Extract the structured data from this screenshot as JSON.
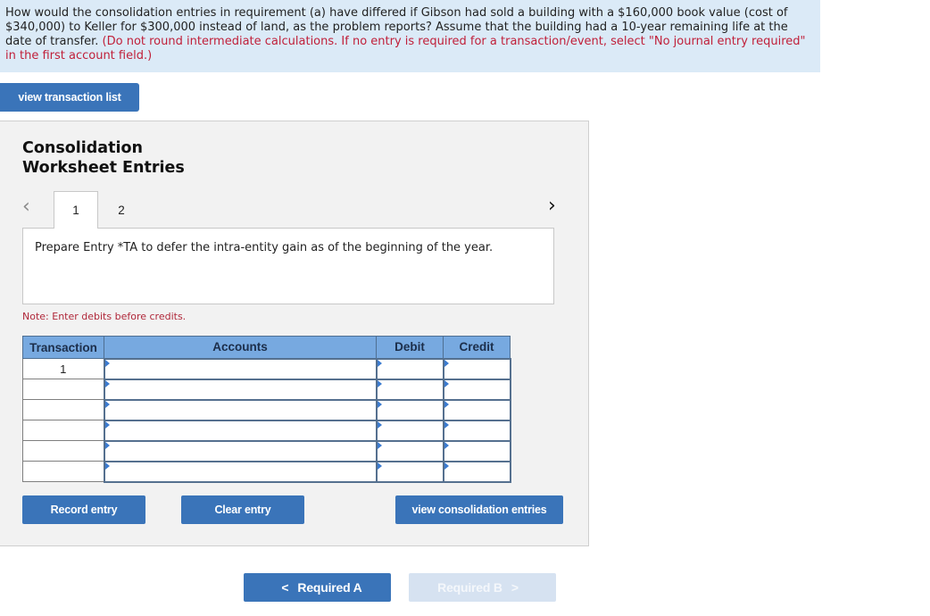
{
  "question": {
    "text": "How would the consolidation entries in requirement (a) have differed if Gibson had sold a building with a $160,000 book value (cost of $340,000) to Keller for $300,000 instead of land, as the problem reports? Assume that the building had a 10-year remaining life at the date of transfer.",
    "hint": "(Do not round intermediate calculations. If no entry is required for a transaction/event, select \"No journal entry required\" in the first account field.)"
  },
  "view_transaction_list_label": "view transaction list",
  "panel": {
    "title_line1": "Consolidation",
    "title_line2": "Worksheet Entries",
    "tabs": [
      {
        "label": "1",
        "active": true
      },
      {
        "label": "2",
        "active": false
      }
    ],
    "prev_icon": "chevron-left-icon",
    "next_icon": "chevron-right-icon",
    "prompt": "Prepare Entry *TA to defer the intra-entity gain as of the beginning of the year.",
    "note": "Note: Enter debits before credits.",
    "table": {
      "headers": [
        "Transaction",
        "Accounts",
        "Debit",
        "Credit"
      ],
      "rows": [
        {
          "transaction": "1",
          "account": "",
          "debit": "",
          "credit": ""
        },
        {
          "transaction": "",
          "account": "",
          "debit": "",
          "credit": ""
        },
        {
          "transaction": "",
          "account": "",
          "debit": "",
          "credit": ""
        },
        {
          "transaction": "",
          "account": "",
          "debit": "",
          "credit": ""
        },
        {
          "transaction": "",
          "account": "",
          "debit": "",
          "credit": ""
        },
        {
          "transaction": "",
          "account": "",
          "debit": "",
          "credit": ""
        }
      ]
    },
    "buttons": {
      "record": "Record entry",
      "clear": "Clear entry",
      "view_consolidation": "view consolidation entries"
    }
  },
  "nav": {
    "prev_label": "Required A",
    "next_label": "Required B",
    "next_enabled": false
  },
  "colors": {
    "accent": "#3a74b9",
    "question_bg": "#dbeaf7",
    "hint_red": "#c0203a",
    "table_header": "#77a9e0",
    "disabled_button": "#d6e2f1"
  }
}
